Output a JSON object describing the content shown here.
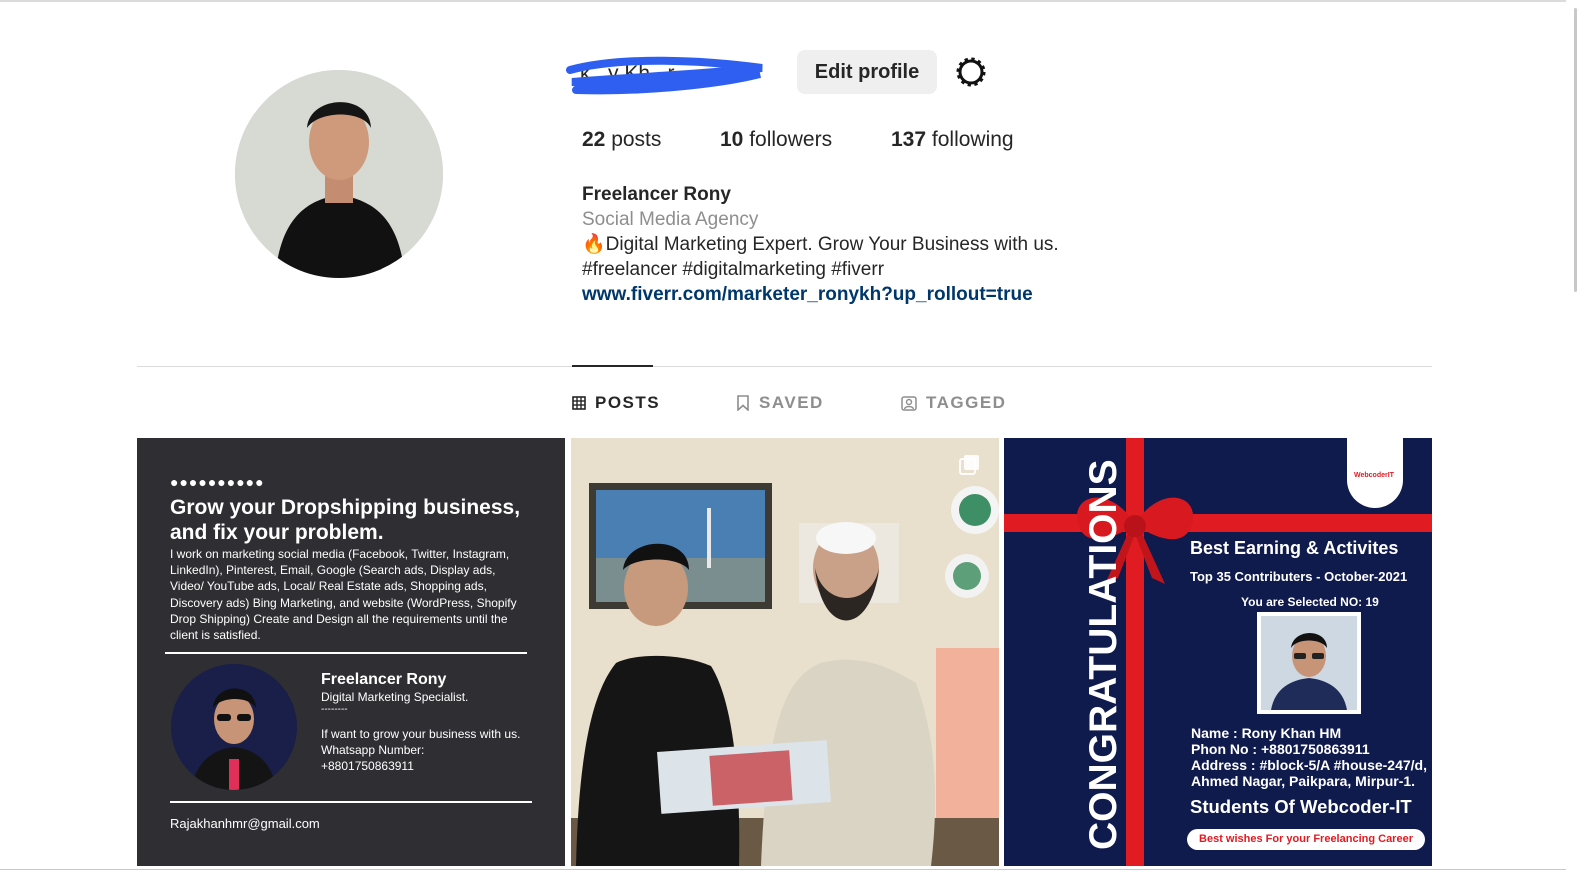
{
  "profile": {
    "username": "k...y Kh...r",
    "edit_profile_label": "Edit profile",
    "settings_icon": "settings-gear-icon",
    "stats": {
      "posts_count": "22",
      "posts_label": "posts",
      "followers_count": "10",
      "followers_label": "followers",
      "following_count": "137",
      "following_label": "following"
    },
    "bio": {
      "name": "Freelancer Rony",
      "category": "Social Media Agency",
      "line1": "🔥Digital Marketing Expert. Grow Your Business with us.",
      "line2": "#freelancer #digitalmarketing #fiverr",
      "link": "www.fiverr.com/marketer_ronykh?up_rollout=true"
    }
  },
  "tabs": [
    {
      "label": "POSTS",
      "icon": "grid-icon",
      "active": true
    },
    {
      "label": "SAVED",
      "icon": "bookmark-icon",
      "active": false
    },
    {
      "label": "TAGGED",
      "icon": "tagged-icon",
      "active": false
    }
  ],
  "posts": {
    "post1": {
      "dots": "●●●●●●●●●●",
      "headline": "Grow your Dropshipping business, and fix your problem.",
      "body": "I work on marketing social media (Facebook, Twitter, Instagram, LinkedIn), Pinterest, Email, Google (Search ads, Display ads, Video/ YouTube ads, Local/ Real Estate ads, Shopping ads, Discovery ads) Bing Marketing, and website (WordPress, Shopify Drop Shipping) Create and Design all the requirements until the client is satisfied.",
      "name": "Freelancer Rony",
      "role": "Digital Marketing Specialist.",
      "dash": "--------",
      "note": "If want to grow your business with us.",
      "whatsapp_label": "Whatsapp Number:",
      "whatsapp": "+8801750863911",
      "email": "Rajakhanhmr@gmail.com"
    },
    "post2": {
      "multi_icon": "multiple-photos-icon"
    },
    "post3": {
      "logo": "WebcoderIT",
      "congrats": "CONGRATULATIONS",
      "title": "Best Earning &  Activites",
      "subtitle": "Top 35 Contributers - October-2021",
      "selected": "You are Selected NO: 19",
      "name_line": "Name      : Rony Khan HM",
      "phone_line": "Phon No : +8801750863911",
      "address_line1": "Address : #block-5/A #house-247/d,",
      "address_line2": "Ahmed Nagar, Paikpara, Mirpur-1.",
      "students": "Students Of Webcoder-IT",
      "wish": "Best wishes For your Freelancing Career"
    }
  }
}
